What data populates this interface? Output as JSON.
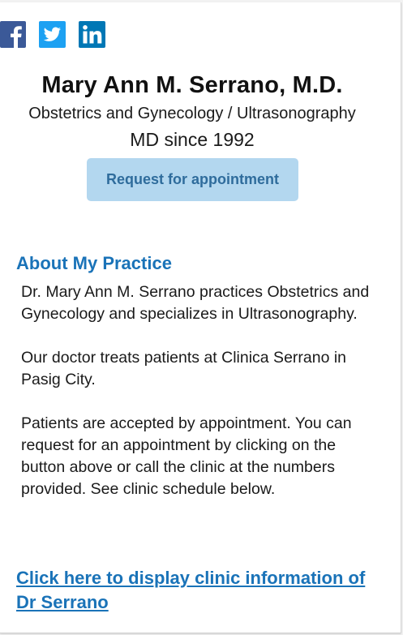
{
  "social": {
    "facebook_icon": "facebook-icon",
    "twitter_icon": "twitter-icon",
    "linkedin_icon": "linkedin-icon",
    "facebook_color": "#3b5998",
    "twitter_color": "#1da1f2",
    "linkedin_color": "#0077b5"
  },
  "doctor": {
    "name": "Mary Ann M. Serrano, M.D.",
    "specialty": "Obstetrics and Gynecology / Ultrasonography",
    "since": "MD since 1992"
  },
  "appointment_button": {
    "label": "Request for appointment"
  },
  "about": {
    "title": "About My Practice",
    "paragraphs": [
      "Dr. Mary Ann M. Serrano practices Obstetrics and Gynecology and specializes in Ultrasonography.",
      "Our doctor treats patients at Clinica Serrano in Pasig City.",
      "Patients are accepted by appointment. You can request for an appointment by clicking on the button above or call the clinic at the numbers provided. See clinic schedule below."
    ]
  },
  "clinic_link": {
    "label": "Click here to display clinic information of Dr Serrano"
  },
  "colors": {
    "accent": "#1a73b8",
    "button_bg": "#b3d7ef",
    "button_text": "#2f6c9c"
  }
}
